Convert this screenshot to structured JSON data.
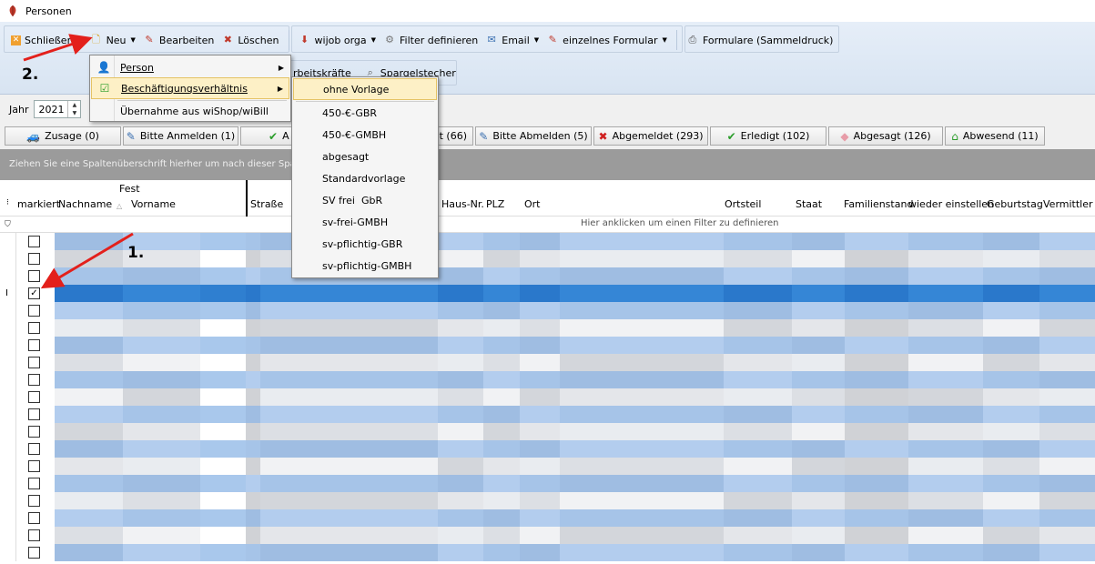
{
  "window": {
    "title": "Personen"
  },
  "toolbar": {
    "close": "Schließen",
    "new": "Neu",
    "edit": "Bearbeiten",
    "delete": "Löschen",
    "wijob": "wijob orga",
    "filter": "Filter definieren",
    "email": "Email",
    "single_form": "einzelnes Formular",
    "forms_bulk": "Formulare (Sammeldruck)",
    "row2_a": "rbeitskräfte",
    "row2_b": "Spargelstecher"
  },
  "year": {
    "label": "Jahr",
    "value": "2021"
  },
  "status_tabs": [
    {
      "label": "Zusage (0)",
      "icon": "car-icon"
    },
    {
      "label": "Bitte Anmelden (1)",
      "icon": "form-icon"
    },
    {
      "label": "A",
      "icon": "check-icon"
    },
    {
      "label": "llt (66)",
      "icon": ""
    },
    {
      "label": "Bitte Abmelden (5)",
      "icon": "form-icon"
    },
    {
      "label": "Abgemeldet (293)",
      "icon": "x-icon"
    },
    {
      "label": "Erledigt (102)",
      "icon": "check-icon"
    },
    {
      "label": "Abgesagt (126)",
      "icon": "eraser-icon"
    },
    {
      "label": "Abwesend (11)",
      "icon": "house-icon"
    }
  ],
  "group_hint": "Ziehen Sie eine Spaltenüberschrift hierher um nach dieser Spalte",
  "columns": {
    "fest": "Fest",
    "markiert": "markiert",
    "nachname": "Nachname",
    "vorname": "Vorname",
    "strasse": "Straße",
    "hausnr": "Haus-Nr.",
    "plz": "PLZ",
    "ort": "Ort",
    "ortsteil": "Ortsteil",
    "staat": "Staat",
    "familienstand": "Familienstand",
    "wieder": "wieder einstellen",
    "geburtstag": "Geburtstag",
    "vermittler": "Vermittler"
  },
  "filter_hint": "Hier anklicken um einen Filter zu definieren",
  "menu_new": [
    {
      "label": "Person",
      "submenu": true
    },
    {
      "label": "Beschäftigungsverhältnis",
      "submenu": true
    },
    {
      "label": "Übernahme aus wiShop/wiBill",
      "submenu": false
    }
  ],
  "menu_templates": [
    "ohne Vorlage",
    "450-€-GBR",
    "450-€-GMBH",
    "abgesagt",
    "Standardvorlage",
    "SV frei  GbR",
    "sv-frei-GMBH",
    "sv-pflichtig-GBR",
    "sv-pflichtig-GMBH"
  ],
  "annotations": {
    "step1": "1.",
    "step2": "2."
  },
  "rows": {
    "count": 19,
    "checked_index": 3,
    "selected_index": 3
  },
  "colors": {
    "selected_row": "#2f7fd0",
    "stripe": "#a9c8ec",
    "arrow": "#e3201b"
  }
}
